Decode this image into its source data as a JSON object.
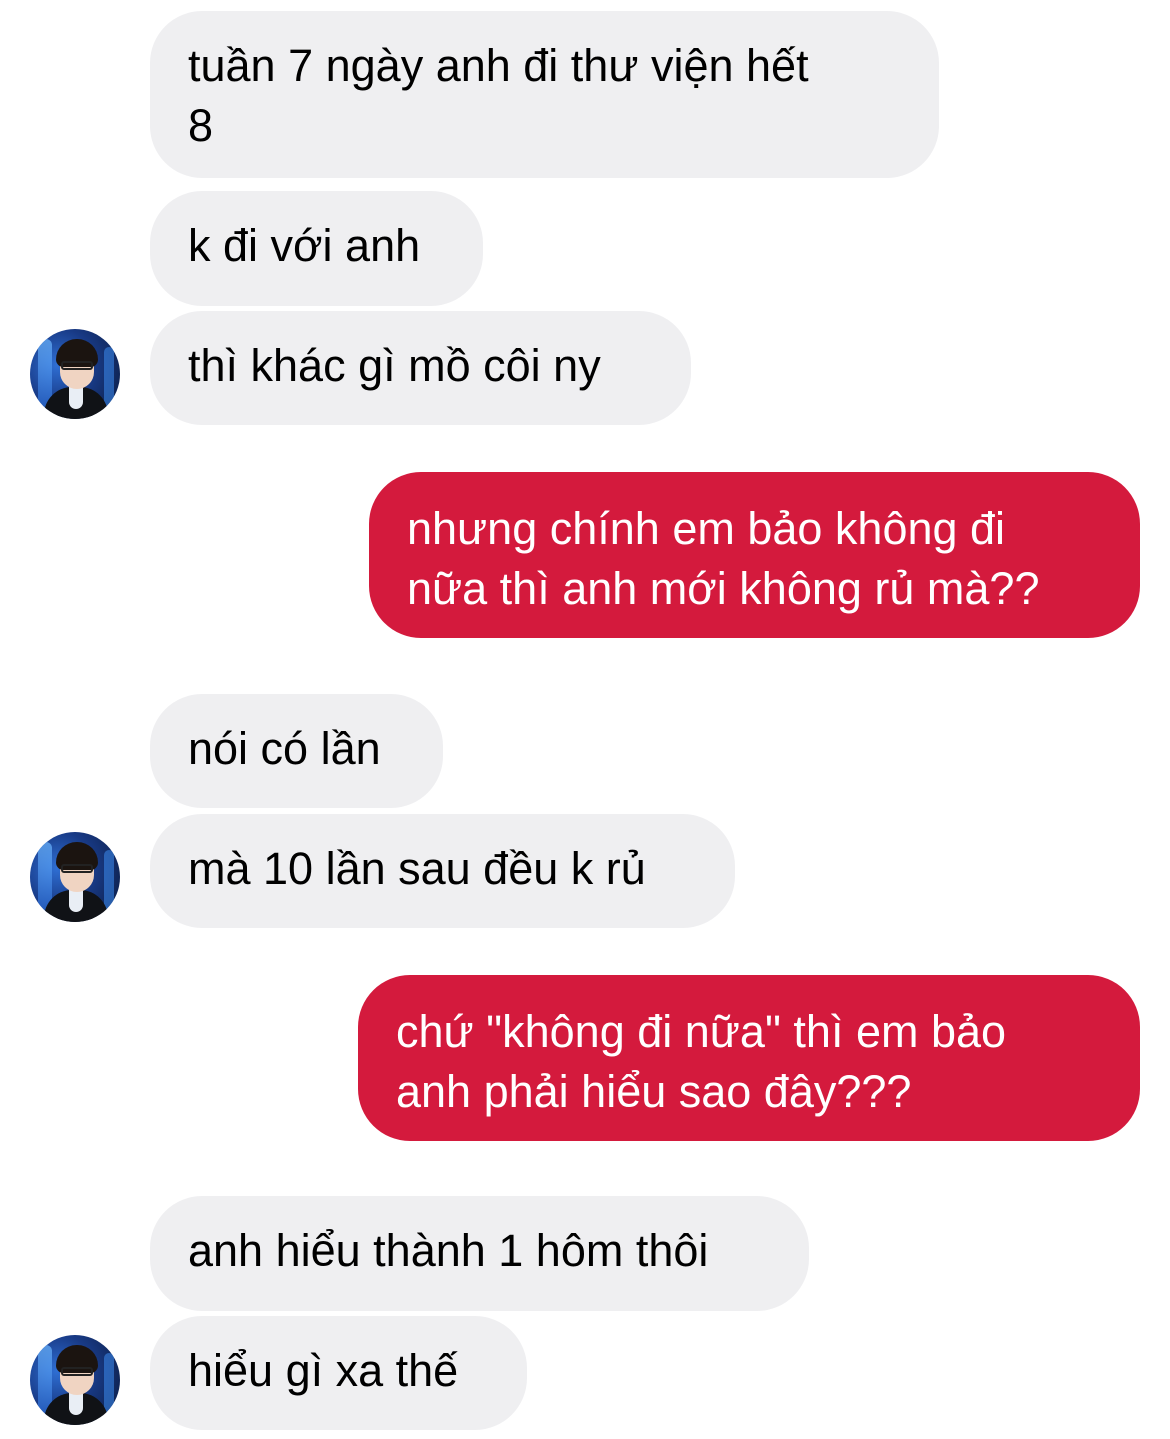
{
  "colors": {
    "incoming_bubble": "#efeff1",
    "outgoing_bubble": "#d41a3d",
    "incoming_text": "#000000",
    "outgoing_text": "#ffffff"
  },
  "messages": [
    {
      "sender": "them",
      "lines": [
        "tuần 7 ngày anh đi thư viện hết",
        "8"
      ]
    },
    {
      "sender": "them",
      "lines": [
        "k đi với anh"
      ]
    },
    {
      "sender": "them",
      "lines": [
        "thì khác gì mồ côi ny"
      ],
      "avatar": "contact-avatar"
    },
    {
      "sender": "me",
      "lines": [
        "nhưng chính em bảo không đi",
        "nữa thì anh mới không rủ mà??"
      ]
    },
    {
      "sender": "them",
      "lines": [
        "nói có lần"
      ]
    },
    {
      "sender": "them",
      "lines": [
        "mà 10 lần sau đều k rủ"
      ],
      "avatar": "contact-avatar"
    },
    {
      "sender": "me",
      "lines": [
        "chứ \"không đi nữa\" thì em bảo",
        "anh phải hiểu sao đây???"
      ]
    },
    {
      "sender": "them",
      "lines": [
        "anh hiểu thành 1 hôm thôi"
      ]
    },
    {
      "sender": "them",
      "lines": [
        "hiểu gì xa thế"
      ],
      "avatar": "contact-avatar"
    }
  ]
}
